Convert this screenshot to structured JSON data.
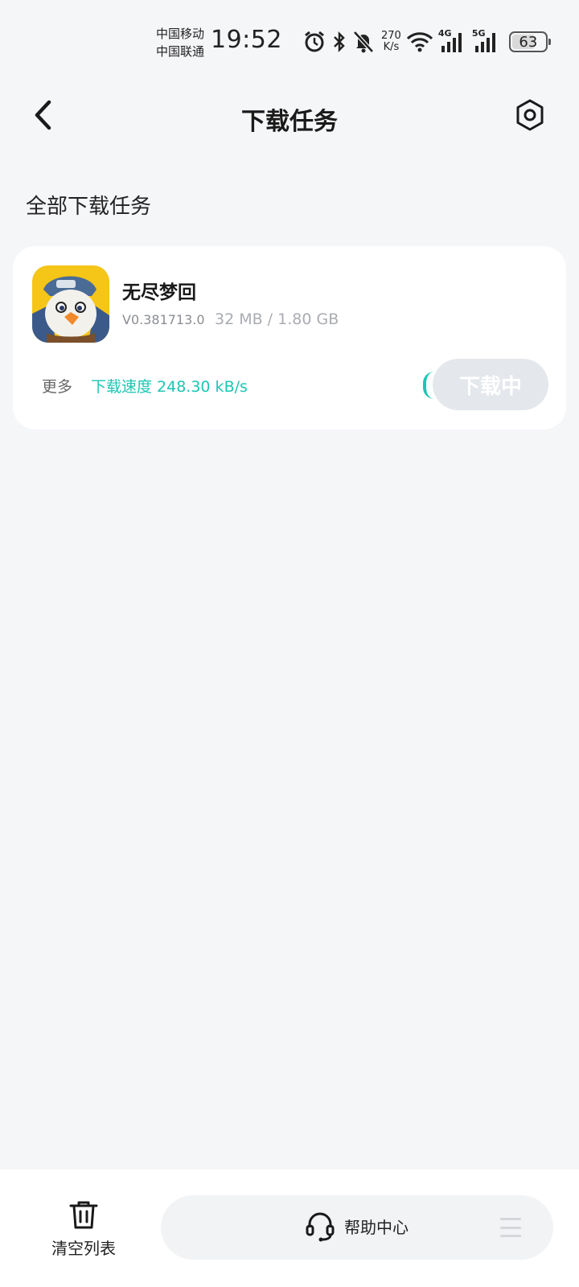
{
  "status_bar": {
    "carrier_1": "中国移动",
    "carrier_2": "中国联通",
    "time": "19:52",
    "net_speed_value": "270",
    "net_speed_unit": "K/s",
    "signal_1_label": "4G",
    "signal_2_label": "5G",
    "battery_level": "63"
  },
  "header": {
    "title": "下载任务"
  },
  "section": {
    "title": "全部下载任务"
  },
  "task": {
    "name": "无尽梦回",
    "version": "V0.381713.0",
    "progress": "32 MB / 1.80 GB",
    "more_label": "更多",
    "speed": "下载速度 248.30 kB/s",
    "button_label": "下载中"
  },
  "bottom_bar": {
    "clear_label": "清空列表",
    "help_label": "帮助中心"
  },
  "colors": {
    "accent": "#1bc6b4",
    "background": "#f5f6f8",
    "card": "#ffffff",
    "button_disabled": "#e4e7eb"
  }
}
